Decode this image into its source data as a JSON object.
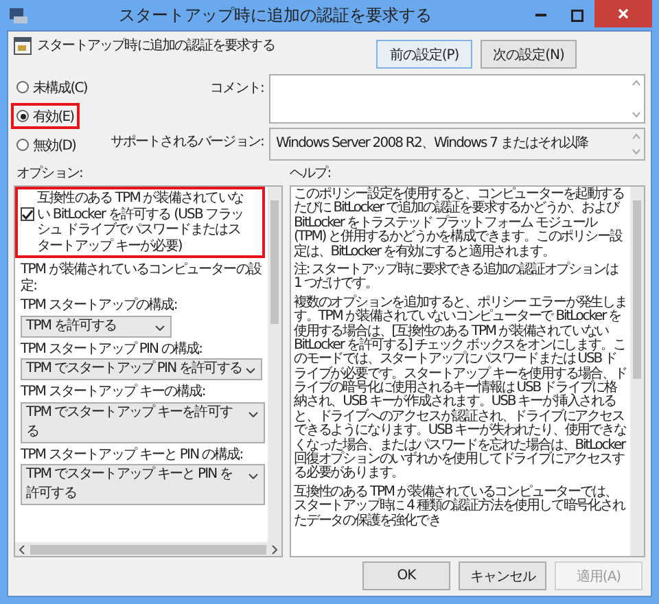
{
  "window": {
    "title": "スタートアップ時に追加の認証を要求する"
  },
  "header": {
    "title": "スタートアップ時に追加の認証を要求する",
    "buttons": [
      "前の設定(P)",
      "次の設定(N)"
    ]
  },
  "radios": [
    {
      "label": "未構成(C)",
      "selected": false,
      "highlighted": false
    },
    {
      "label": "有効(E)",
      "selected": true,
      "highlighted": true
    },
    {
      "label": "無効(D)",
      "selected": false,
      "highlighted": false
    }
  ],
  "comment": {
    "label": "コメント:"
  },
  "supported": {
    "label": "サポートされるバージョン:",
    "value": "Windows Server 2008 R2、Windows 7 またはそれ以降"
  },
  "options": {
    "label": "オプション:",
    "items": [
      {
        "kind": "checkbox",
        "label": "互換性のある TPM が装備されていない BitLocker を許可する (USB フラッシュ ドライブでパスワードまたはスタートアップ キーが必要)",
        "checked": true,
        "highlighted": true
      },
      {
        "kind": "text",
        "label": "TPM が装備されているコンピューターの設定:"
      },
      {
        "kind": "text",
        "label": "TPM スタートアップの構成:"
      },
      {
        "kind": "select",
        "value": "TPM を許可する"
      },
      {
        "kind": "text",
        "label": "TPM スタートアップ PIN の構成:"
      },
      {
        "kind": "select",
        "value": "TPM でスタートアップ PIN を許可する"
      },
      {
        "kind": "text",
        "label": "TPM スタートアップ キーの構成:"
      },
      {
        "kind": "select",
        "value": "TPM でスタートアップ キーを許可する"
      },
      {
        "kind": "text",
        "label": "TPM スタートアップ キーと PIN の構成:"
      },
      {
        "kind": "select",
        "value": "TPM でスタートアップ キーと PIN を許可する"
      }
    ]
  },
  "help": {
    "label": "ヘルプ:",
    "paragraphs": [
      "このポリシー設定を使用すると、コンピューターを起動するたびに BitLocker で追加の認証を要求するかどうか、および BitLocker をトラステッド プラットフォーム モジュール (TPM) と併用するかどうかを構成できます。このポリシー設定は、BitLocker を有効にすると適用されます。",
      "注: スタートアップ時に要求できる追加の認証オプションは 1 つだけです。",
      "複数のオプションを追加すると、ポリシー エラーが発生します。TPM が装備されていないコンピューターで BitLocker を使用する場合は、[互換性のある TPM が装備されていない BitLocker を許可する] チェック ボックスをオンにします。このモードでは、スタートアップにパスワードまたは USB ドライブが必要です。スタートアップ キーを使用する場合、ドライブの暗号化に使用されるキー情報は USB ドライブに格納され、USB キーが作成されます。USB キーが挿入されると、ドライブへのアクセスが認証され、ドライブにアクセスできるようになります。USB キーが失われたり、使用できなくなった場合、またはパスワードを忘れた場合は、BitLocker 回復オプションのいずれかを使用してドライブにアクセスする必要があります。",
      "互換性のある TPM が装備されているコンピューターでは、スタートアップ時に 4 種類の認証方法を使用して暗号化されたデータの保護を強化でき"
    ]
  },
  "footer": [
    {
      "label": "OK",
      "disabled": false
    },
    {
      "label": "キャンセル",
      "disabled": false
    },
    {
      "label": "適用(A)",
      "disabled": true
    }
  ]
}
